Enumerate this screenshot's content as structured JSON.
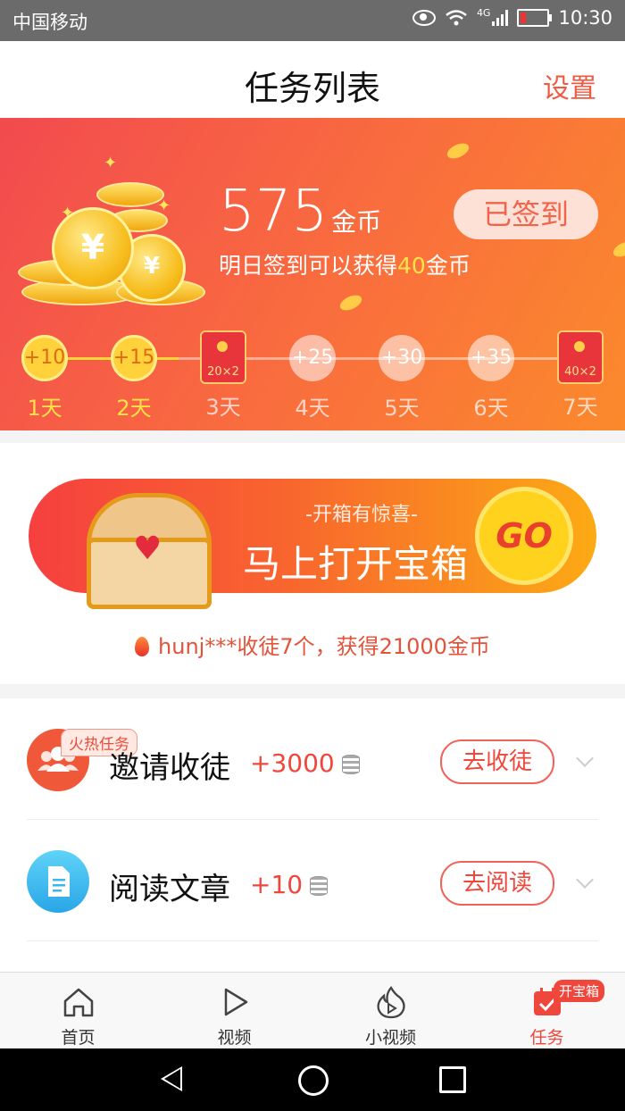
{
  "status_bar": {
    "carrier": "中国移动",
    "network": "4G",
    "time": "10:30"
  },
  "header": {
    "title": "任务列表",
    "settings_label": "设置"
  },
  "checkin": {
    "coins": "575",
    "coins_unit": "金币",
    "tip_prefix": "明日签到可以获得",
    "tip_amount": "40",
    "tip_suffix": "金币",
    "signed_label": "已签到",
    "days": [
      {
        "reward": "+10",
        "label": "1天",
        "state": "done"
      },
      {
        "reward": "+15",
        "label": "2天",
        "state": "done"
      },
      {
        "reward": "20×2",
        "label": "3天",
        "state": "redpack"
      },
      {
        "reward": "+25",
        "label": "4天",
        "state": "todo"
      },
      {
        "reward": "+30",
        "label": "5天",
        "state": "todo"
      },
      {
        "reward": "+35",
        "label": "6天",
        "state": "todo"
      },
      {
        "reward": "40×2",
        "label": "7天",
        "state": "redpack"
      }
    ]
  },
  "treasure": {
    "subtitle": "-开箱有惊喜-",
    "title": "马上打开宝箱",
    "go_label": "GO",
    "ticker": "hunj***收徒7个，获得21000金币"
  },
  "tasks": [
    {
      "name": "邀请收徒",
      "reward": "+3000",
      "action": "去收徒",
      "badge": "火热任务",
      "icon": "group-icon",
      "color": "#f0583a"
    },
    {
      "name": "阅读文章",
      "reward": "+10",
      "action": "去阅读",
      "icon": "document-icon",
      "color": "#3bb6ee"
    }
  ],
  "tabbar": {
    "tabs": [
      {
        "label": "首页",
        "icon": "home-icon"
      },
      {
        "label": "视频",
        "icon": "play-icon"
      },
      {
        "label": "小视频",
        "icon": "flame-play-icon"
      },
      {
        "label": "任务",
        "icon": "task-calendar-icon",
        "active": true
      }
    ],
    "badge": "开宝箱"
  },
  "colors": {
    "accent": "#f0473c",
    "banner_start": "#f24a4f",
    "banner_end": "#fb8a2c",
    "gold": "#ffd23b"
  }
}
